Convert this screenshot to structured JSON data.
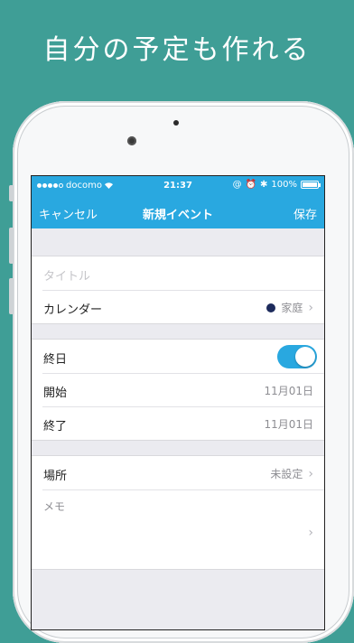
{
  "headline": "自分の予定も作れる",
  "status_bar": {
    "carrier": "docomo",
    "time": "21:37",
    "battery": "100%"
  },
  "navbar": {
    "cancel": "キャンセル",
    "title": "新規イベント",
    "save": "保存"
  },
  "form": {
    "title_placeholder": "タイトル",
    "calendar_label": "カレンダー",
    "calendar_value": "家庭",
    "calendar_color": "#1d2b5c",
    "allday_label": "終日",
    "allday_on": true,
    "start_label": "開始",
    "start_value": "11月01日",
    "end_label": "終了",
    "end_value": "11月01日",
    "location_label": "場所",
    "location_value": "未設定",
    "memo_label": "メモ"
  },
  "colors": {
    "background": "#3f9e96",
    "accent": "#29a8e0"
  }
}
